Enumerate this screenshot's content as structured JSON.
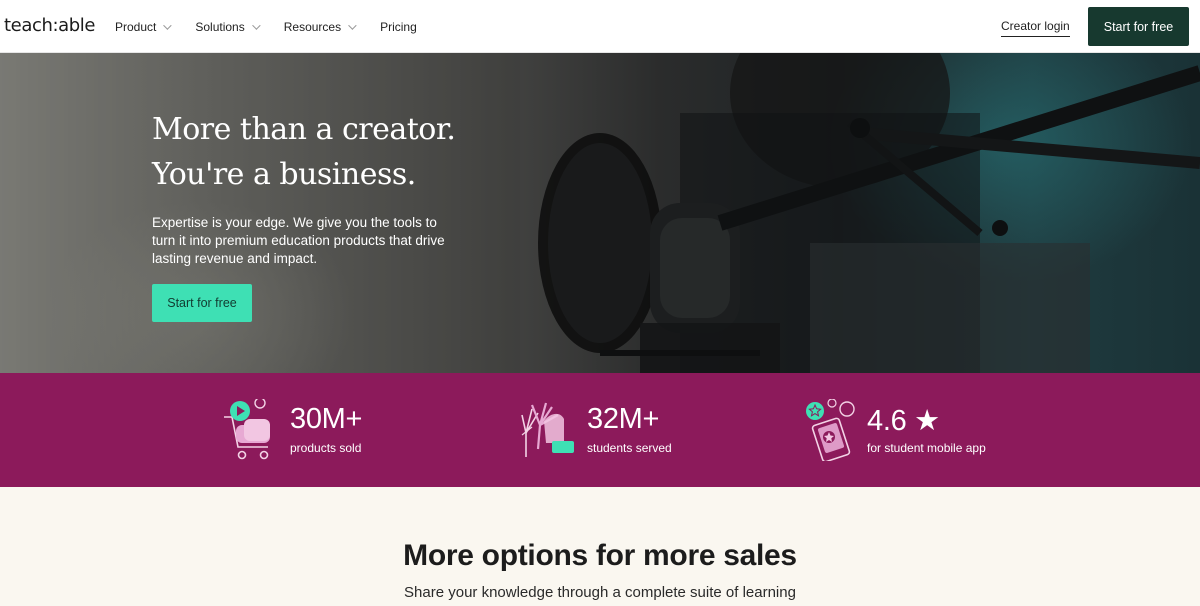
{
  "nav": {
    "logo": "teach:able",
    "menu": [
      {
        "label": "Product",
        "has_dropdown": true
      },
      {
        "label": "Solutions",
        "has_dropdown": true
      },
      {
        "label": "Resources",
        "has_dropdown": true
      },
      {
        "label": "Pricing",
        "has_dropdown": false
      }
    ],
    "login_label": "Creator login",
    "cta_label": "Start for free"
  },
  "hero": {
    "title_line1": "More than a creator.",
    "title_line2": "You're a business.",
    "subtitle": "Expertise is your edge. We give you the tools to turn it into premium education products that drive lasting revenue and impact.",
    "cta_label": "Start for free"
  },
  "stats": [
    {
      "value": "30M+",
      "label": "products sold",
      "icon": "shopping-cart-icon"
    },
    {
      "value": "32M+",
      "label": "students served",
      "icon": "high-five-icon"
    },
    {
      "value": "4.6 ★",
      "label": "for student mobile app",
      "icon": "mobile-rating-icon"
    }
  ],
  "section": {
    "title": "More options for more sales",
    "subtitle": "Share your knowledge through a complete suite of learning"
  },
  "colors": {
    "nav_cta": "#17392f",
    "hero_cta": "#3ee0b4",
    "stats_bg": "#8c1a5b",
    "section_bg": "#faf7f0"
  }
}
